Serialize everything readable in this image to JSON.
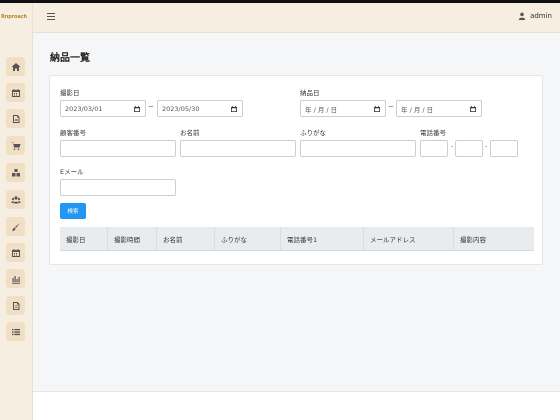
{
  "app": {
    "logo_text": "Rnproach"
  },
  "topbar": {
    "user_name": "admin"
  },
  "sidebar": {
    "items": [
      {
        "icon": "home-icon"
      },
      {
        "icon": "calendar-icon"
      },
      {
        "icon": "file-icon"
      },
      {
        "icon": "cart-icon"
      },
      {
        "icon": "cubes-icon"
      },
      {
        "icon": "users-icon"
      },
      {
        "icon": "brush-icon"
      },
      {
        "icon": "calendar-alt-icon"
      },
      {
        "icon": "chart-icon"
      },
      {
        "icon": "file-alt-icon"
      },
      {
        "icon": "list-icon"
      }
    ]
  },
  "page": {
    "title": "納品一覧"
  },
  "form": {
    "shoot_date_label": "撮影日",
    "shoot_date_from": "2023/03/01",
    "shoot_date_to": "2023/05/30",
    "delivery_date_label": "納品日",
    "delivery_date_from": "年 / 月 / 日",
    "delivery_date_to": "年 / 月 / 日",
    "range_sep": "~",
    "customer_no_label": "顧客番号",
    "customer_no_value": "",
    "name_label": "お名前",
    "name_value": "",
    "furigana_label": "ふりがな",
    "furigana_value": "",
    "phone_label": "電話番号",
    "phone_1": "",
    "phone_2": "",
    "phone_3": "",
    "phone_sep": "-",
    "email_label": "Eメール",
    "email_value": "",
    "search_button": "検索"
  },
  "table": {
    "columns": [
      "撮影日",
      "撮影時間",
      "お名前",
      "ふりがな",
      "電話番号1",
      "メールアドレス",
      "撮影内容"
    ]
  }
}
